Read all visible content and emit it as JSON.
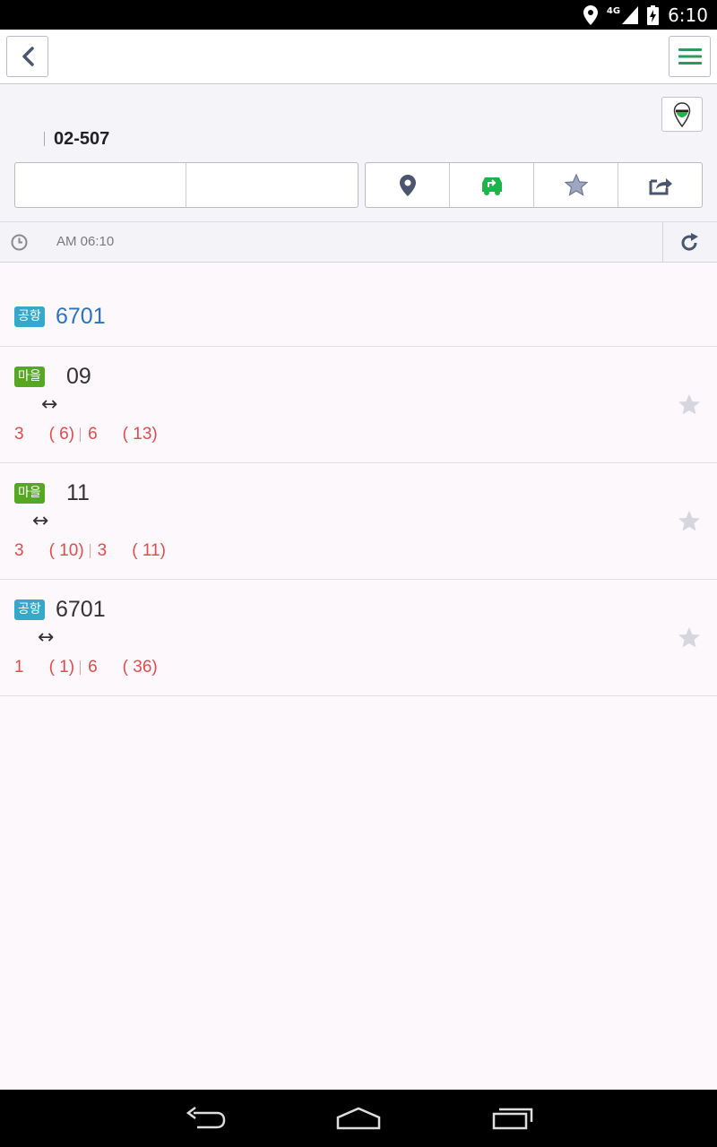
{
  "status_bar": {
    "time": "6:10",
    "network": "4G"
  },
  "stop": {
    "code": "02-507"
  },
  "refresh": {
    "time": "AM 06:10"
  },
  "header_route": {
    "badge": "공항",
    "number": "6701"
  },
  "routes": [
    {
      "badge": "마을",
      "badge_type": "village",
      "number": "09",
      "direction_symbol": "↔",
      "arrival_1_min": "3",
      "arrival_1_stops": "( 6)",
      "arrival_2_min": "6",
      "arrival_2_stops": "( 13)"
    },
    {
      "badge": "마을",
      "badge_type": "village",
      "number": "11",
      "direction_symbol": "↔",
      "arrival_1_min": "3",
      "arrival_1_stops": "( 10)",
      "arrival_2_min": "3",
      "arrival_2_stops": "( 11)"
    },
    {
      "badge": "공항",
      "badge_type": "airport",
      "number": "6701",
      "direction_symbol": "↔",
      "arrival_1_min": "1",
      "arrival_1_stops": "( 1)",
      "arrival_2_min": "6",
      "arrival_2_stops": "( 36)"
    }
  ],
  "icons": {
    "back": "chevron-left-icon",
    "menu": "hamburger-menu-icon",
    "map_marker": "map-pin-icon",
    "location": "location-pin-icon",
    "transfer": "bus-transfer-icon",
    "favorite": "star-icon",
    "share": "share-icon",
    "clock": "clock-icon",
    "refresh": "refresh-icon"
  },
  "colors": {
    "accent_green": "#1db54a",
    "menu_green": "#2c9a5d",
    "airport_badge": "#36a8c9",
    "village_badge": "#56a822",
    "arrival_red": "#e04c4c",
    "route_blue": "#2b72c3"
  }
}
